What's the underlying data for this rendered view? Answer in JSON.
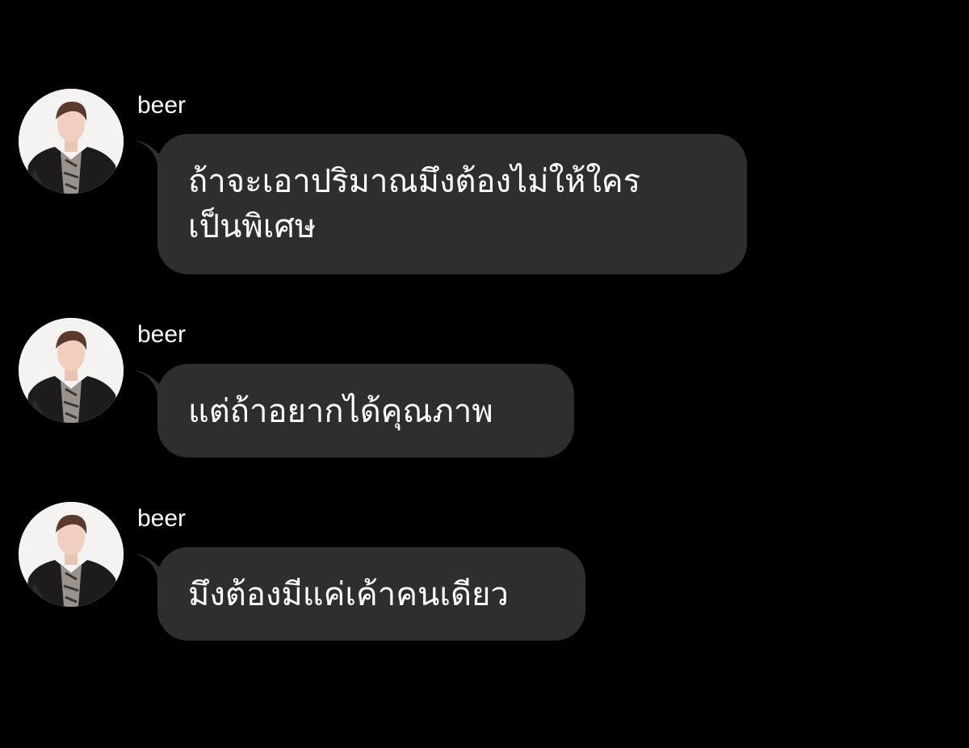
{
  "colors": {
    "background": "#000000",
    "bubble": "#2e2e2e",
    "text": "#ffffff",
    "avatar_background": "#f4f3f1"
  },
  "messages": [
    {
      "sender": "beer",
      "avatar_icon": "user-photo-avatar",
      "text": "ถ้าจะเอาปริมาณมึงต้องไม่ให้ใคร\nเป็นพิเศษ"
    },
    {
      "sender": "beer",
      "avatar_icon": "user-photo-avatar",
      "text": "แต่ถ้าอยากได้คุณภาพ"
    },
    {
      "sender": "beer",
      "avatar_icon": "user-photo-avatar",
      "text": "มึงต้องมีแค่เค้าคนเดียว"
    }
  ]
}
